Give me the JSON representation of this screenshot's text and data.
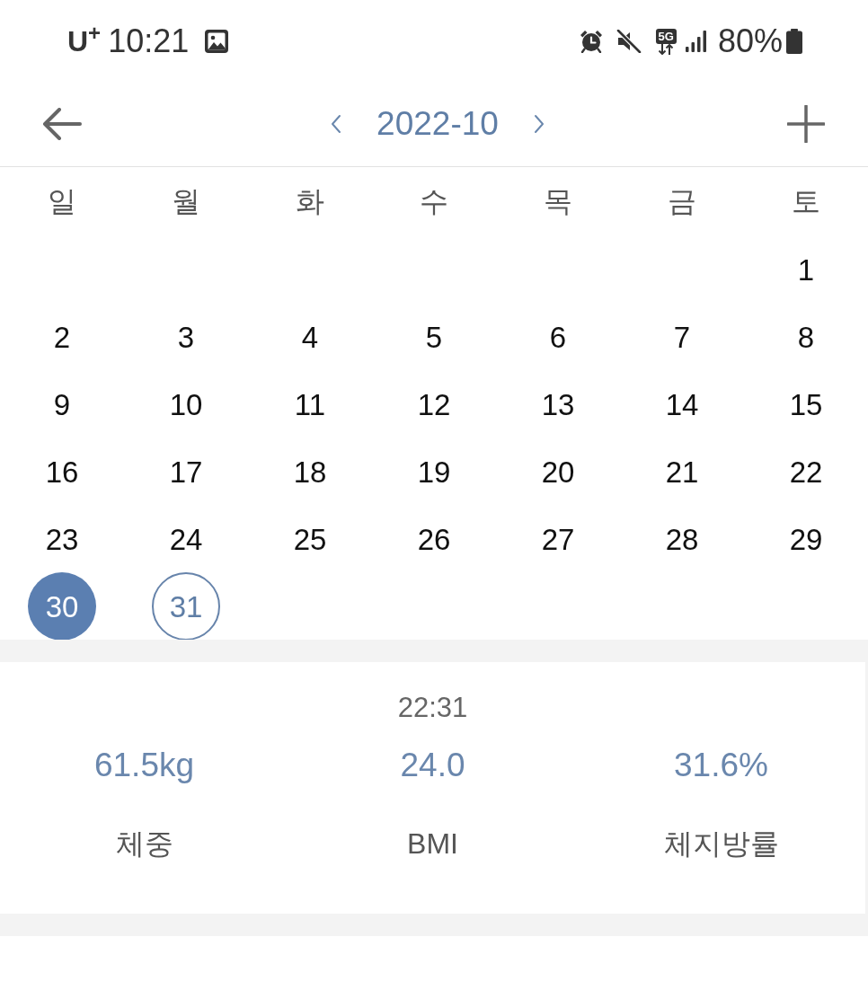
{
  "status_bar": {
    "carrier": "U$^{+}$",
    "time": "10:21",
    "network_type": "5G",
    "battery": "80%"
  },
  "header": {
    "title": "2022-10"
  },
  "calendar": {
    "weekdays": [
      "일",
      "월",
      "화",
      "수",
      "목",
      "금",
      "토"
    ],
    "weeks": [
      {
        "days": [
          {
            "label": "1",
            "selected": false,
            "today": false
          }
        ]
      },
      {
        "days": [
          {
            "label": "2",
            "selected": false,
            "today": false
          },
          {
            "label": "3",
            "selected": false,
            "today": false
          },
          {
            "label": "4",
            "selected": false,
            "today": false
          },
          {
            "label": "5",
            "selected": false,
            "today": false
          },
          {
            "label": "6",
            "selected": false,
            "today": false
          },
          {
            "label": "7",
            "selected": false,
            "today": false
          },
          {
            "label": "8",
            "selected": false,
            "today": false
          }
        ]
      },
      {
        "days": [
          {
            "label": "9",
            "selected": false,
            "today": false
          },
          {
            "label": "10",
            "selected": false,
            "today": false
          },
          {
            "label": "11",
            "selected": false,
            "today": false
          },
          {
            "label": "12",
            "selected": false,
            "today": false
          },
          {
            "label": "13",
            "selected": false,
            "today": false
          },
          {
            "label": "14",
            "selected": false,
            "today": false
          },
          {
            "label": "15",
            "selected": false,
            "today": false
          }
        ]
      },
      {
        "days": [
          {
            "label": "16",
            "selected": false,
            "today": false
          },
          {
            "label": "17",
            "selected": false,
            "today": false
          },
          {
            "label": "18",
            "selected": false,
            "today": false
          },
          {
            "label": "19",
            "selected": false,
            "today": false
          },
          {
            "label": "20",
            "selected": false,
            "today": false
          },
          {
            "label": "21",
            "selected": false,
            "today": false
          },
          {
            "label": "22",
            "selected": false,
            "today": false
          }
        ]
      },
      {
        "days": [
          {
            "label": "23",
            "selected": false,
            "today": false
          },
          {
            "label": "24",
            "selected": false,
            "today": false
          },
          {
            "label": "25",
            "selected": false,
            "today": false
          },
          {
            "label": "26",
            "selected": false,
            "today": false
          },
          {
            "label": "27",
            "selected": false,
            "today": false
          },
          {
            "label": "28",
            "selected": false,
            "today": false
          },
          {
            "label": "29",
            "selected": false,
            "today": false
          }
        ]
      },
      {
        "days": [
          {
            "label": "30",
            "selected": true,
            "today": false
          },
          {
            "label": "31",
            "selected": false,
            "today": true
          }
        ]
      }
    ]
  },
  "record": {
    "time": "22:31",
    "metrics": [
      {
        "value": "61.5kg",
        "label": "체중"
      },
      {
        "value": "24.0",
        "label": "BMI"
      },
      {
        "value": "31.6%",
        "label": "체지방률"
      }
    ]
  }
}
